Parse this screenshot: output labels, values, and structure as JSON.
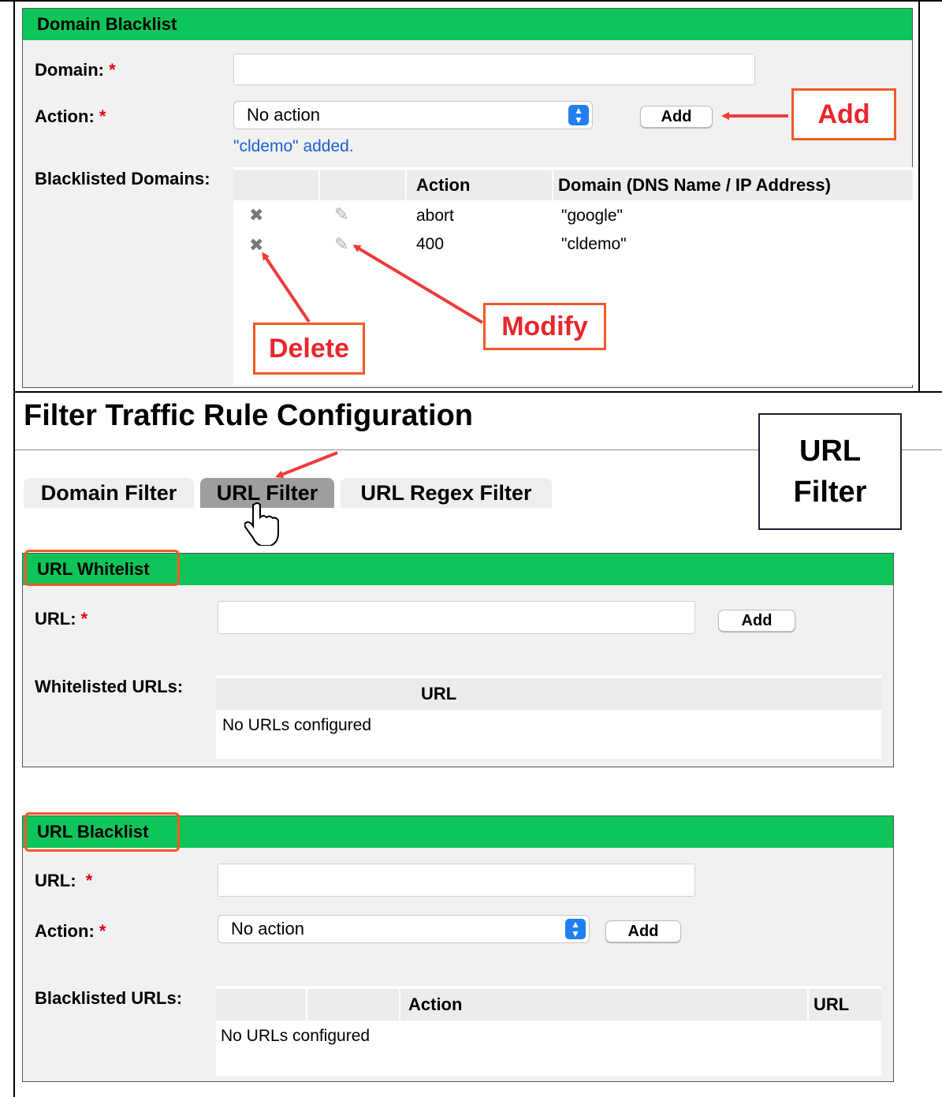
{
  "domain_blacklist": {
    "title": "Domain Blacklist",
    "domain_label": "Domain:",
    "action_label": "Action:",
    "required_mark": "*",
    "action_value": "No action",
    "add_label": "Add",
    "status_message": "\"cldemo\" added.",
    "blacklisted_label": "Blacklisted Domains:",
    "columns": [
      "Action",
      "Domain (DNS Name / IP Address)"
    ],
    "rows": [
      {
        "action": "abort",
        "domain": "\"google\""
      },
      {
        "action": "400",
        "domain": "\"cldemo\""
      }
    ]
  },
  "annotations": {
    "add": "Add",
    "delete": "Delete",
    "modify": "Modify",
    "url_filter_line1": "URL",
    "url_filter_line2": "Filter"
  },
  "page": {
    "title": "Filter Traffic Rule Configuration",
    "tabs": [
      {
        "label": "Domain Filter",
        "active": false
      },
      {
        "label": "URL Filter",
        "active": true
      },
      {
        "label": "URL Regex Filter",
        "active": false
      }
    ]
  },
  "url_whitelist": {
    "title": "URL Whitelist",
    "url_label": "URL:",
    "required_mark": "*",
    "add_label": "Add",
    "listed_label": "Whitelisted URLs:",
    "columns": [
      "URL"
    ],
    "empty_text": "No URLs configured"
  },
  "url_blacklist": {
    "title": "URL Blacklist",
    "url_label": "URL:",
    "action_label": "Action:",
    "required_mark": "*",
    "action_value": "No action",
    "add_label": "Add",
    "listed_label": "Blacklisted URLs:",
    "columns": [
      "Action",
      "URL"
    ],
    "empty_text": "No URLs configured"
  },
  "colors": {
    "header_green": "#0fc459",
    "callout_orange": "#f05a28",
    "arrow_red": "#ee3b3b",
    "status_blue": "#1a5fd0"
  }
}
